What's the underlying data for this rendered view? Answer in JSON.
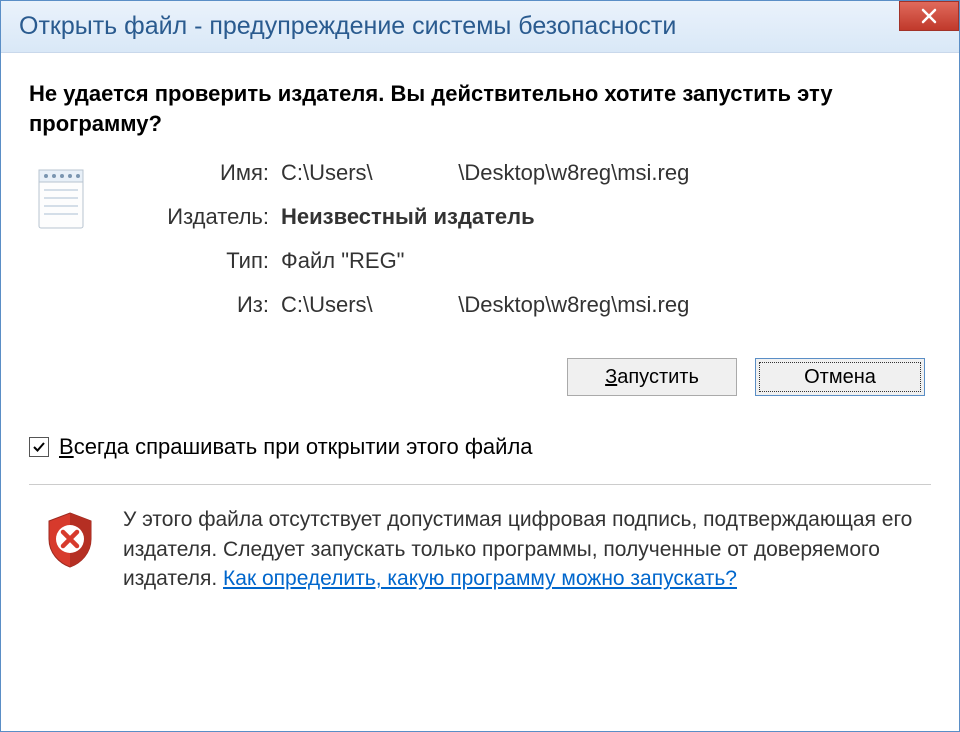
{
  "title": "Открыть файл - предупреждение системы безопасности",
  "warning": "Не удается проверить издателя.  Вы действительно хотите запустить эту программу?",
  "fields": {
    "name_label": "Имя:",
    "name_value": "C:\\Users\\              \\Desktop\\w8reg\\msi.reg",
    "publisher_label": "Издатель:",
    "publisher_value": "Неизвестный издатель",
    "type_label": "Тип:",
    "type_value": "Файл \"REG\"",
    "from_label": "Из:",
    "from_value": "C:\\Users\\              \\Desktop\\w8reg\\msi.reg"
  },
  "buttons": {
    "run_prefix": "З",
    "run_rest": "апустить",
    "cancel": "Отмена"
  },
  "checkbox": {
    "prefix": "В",
    "rest": "сегда спрашивать при открытии этого файла"
  },
  "footer": {
    "text": "У этого файла отсутствует допустимая цифровая подпись, подтверждающая его издателя.  Следует запускать только программы, полученные от доверяемого издателя.  ",
    "link": "Как определить, какую программу можно запускать?"
  }
}
